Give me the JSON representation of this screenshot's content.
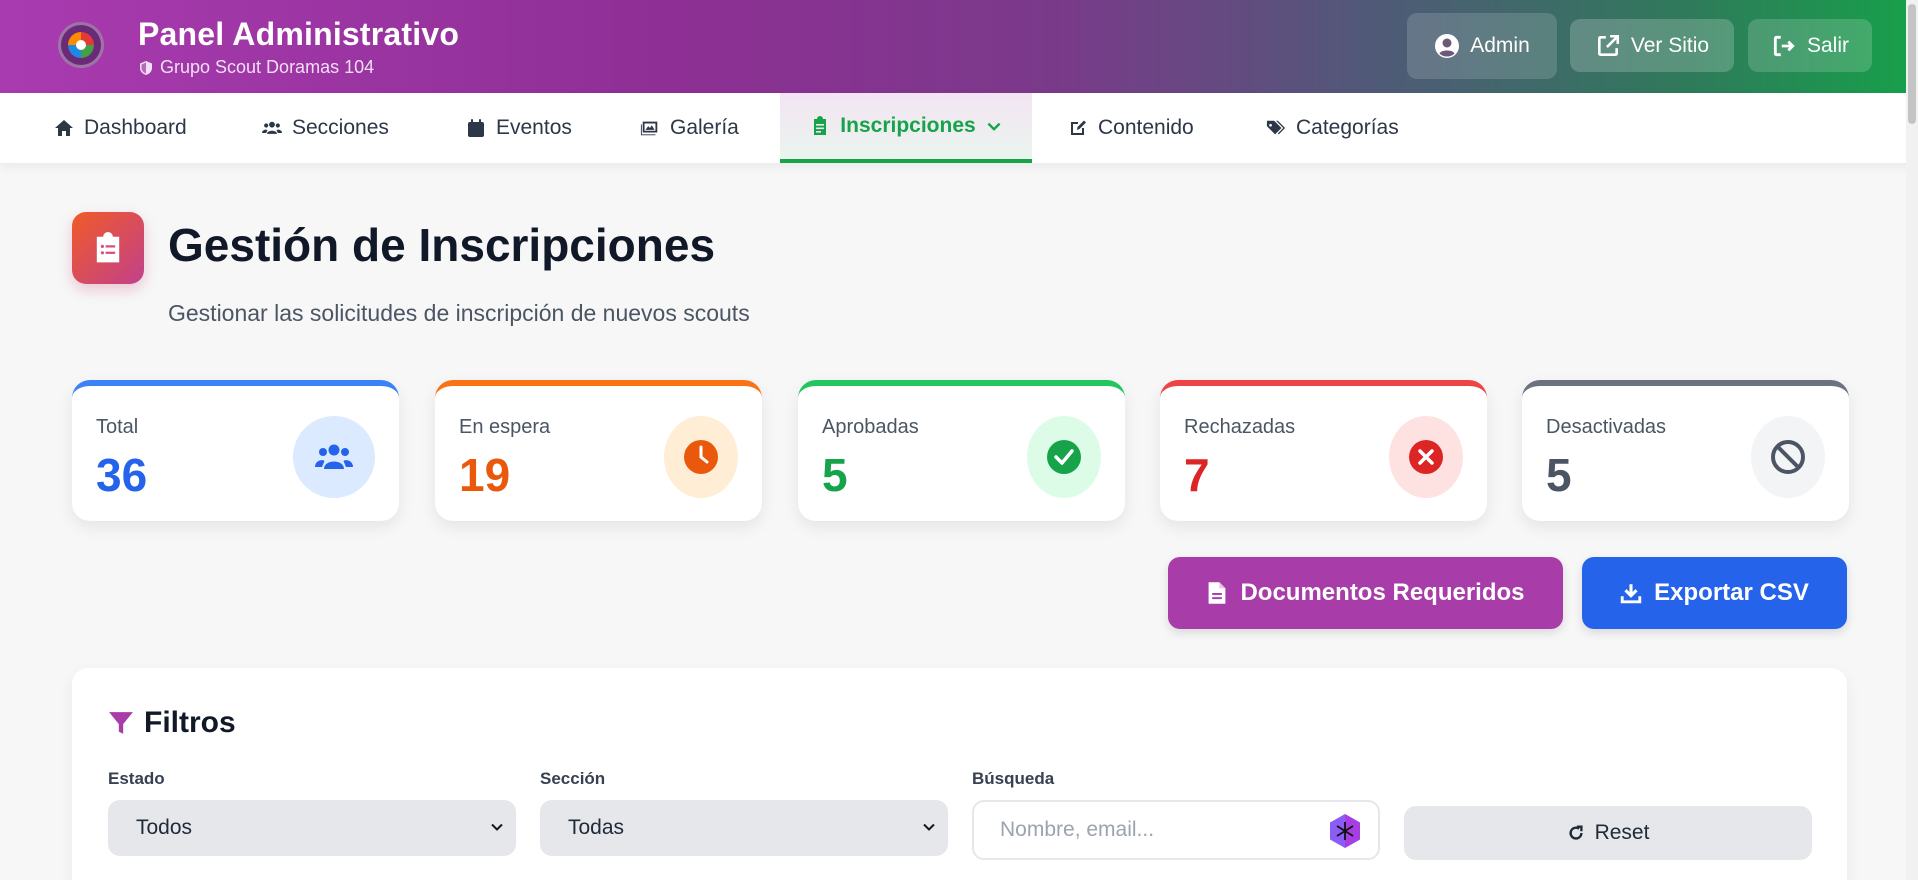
{
  "header": {
    "title": "Panel Administrativo",
    "subtitle": "Grupo Scout Doramas 104",
    "buttons": {
      "admin": "Admin",
      "site": "Ver Sitio",
      "exit": "Salir"
    }
  },
  "nav": {
    "items": [
      {
        "label": "Dashboard",
        "icon": "home-icon"
      },
      {
        "label": "Secciones",
        "icon": "users-icon"
      },
      {
        "label": "Eventos",
        "icon": "calendar-icon"
      },
      {
        "label": "Galería",
        "icon": "images-icon"
      },
      {
        "label": "Inscripciones",
        "icon": "clipboard-icon",
        "active": true
      },
      {
        "label": "Contenido",
        "icon": "edit-icon"
      },
      {
        "label": "Categorías",
        "icon": "tags-icon"
      }
    ]
  },
  "page": {
    "title": "Gestión de Inscripciones",
    "subtitle": "Gestionar las solicitudes de inscripción de nuevos scouts"
  },
  "stats": [
    {
      "label": "Total",
      "value": "36",
      "color": "#2563eb",
      "bg": "#dbeafe",
      "icon": "users-icon"
    },
    {
      "label": "En espera",
      "value": "19",
      "color": "#ea580c",
      "bg": "#ffedd5",
      "icon": "clock-icon"
    },
    {
      "label": "Aprobadas",
      "value": "5",
      "color": "#16a34a",
      "bg": "#dcfce7",
      "icon": "check-icon"
    },
    {
      "label": "Rechazadas",
      "value": "7",
      "color": "#dc2626",
      "bg": "#fee2e2",
      "icon": "x-icon"
    },
    {
      "label": "Desactivadas",
      "value": "5",
      "color": "#4b5563",
      "bg": "#f3f4f6",
      "icon": "ban-icon"
    }
  ],
  "actions": {
    "docs": "Documentos Requeridos",
    "csv": "Exportar CSV"
  },
  "filters": {
    "title": "Filtros",
    "estado_label": "Estado",
    "estado_value": "Todos",
    "seccion_label": "Sección",
    "seccion_value": "Todas",
    "busqueda_label": "Búsqueda",
    "busqueda_placeholder": "Nombre, email...",
    "reset": "Reset"
  }
}
